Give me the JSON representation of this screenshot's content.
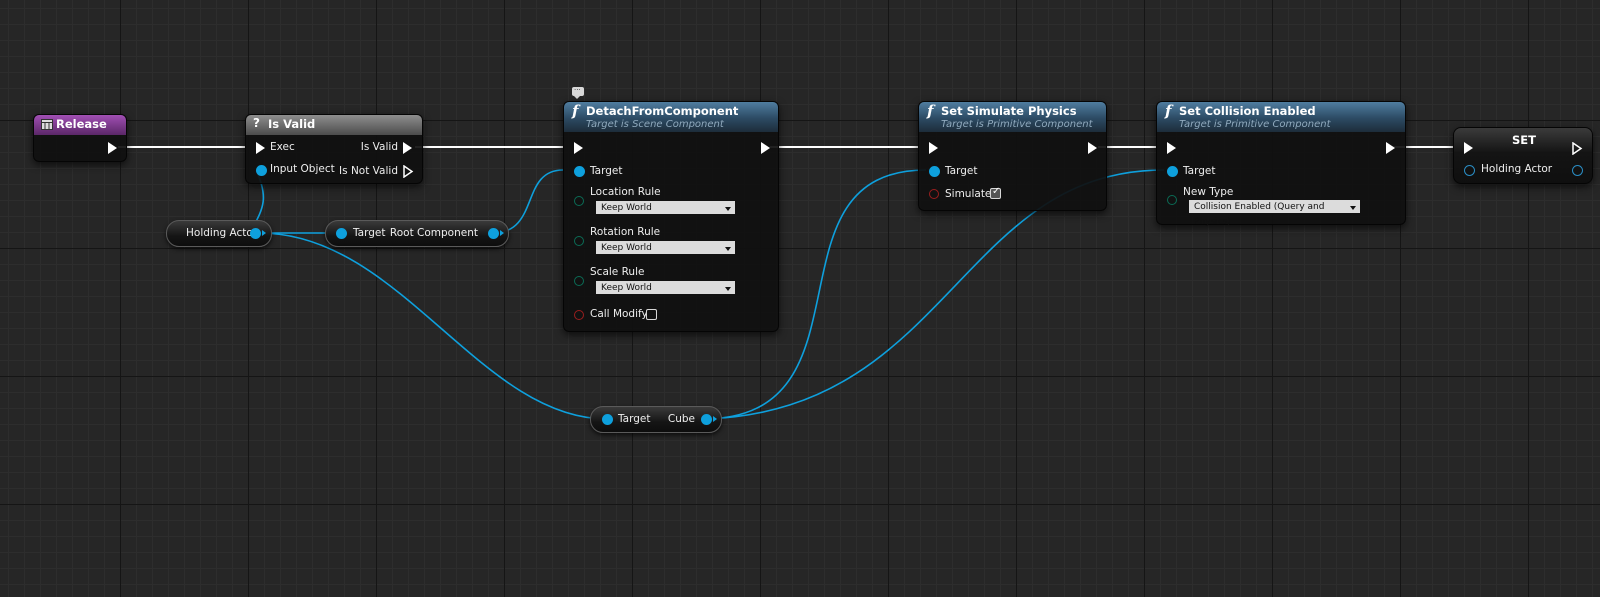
{
  "nodes": {
    "release": {
      "title": "Release"
    },
    "is_valid": {
      "title": "Is Valid",
      "icon": "?",
      "exec_in": "Exec",
      "input_object": "Input Object",
      "is_valid_out": "Is Valid",
      "is_not_valid_out": "Is Not Valid"
    },
    "holding_actor_get": {
      "label": "Holding Actor"
    },
    "root_component_get": {
      "target": "Target",
      "output": "Root Component"
    },
    "detach": {
      "title": "DetachFromComponent",
      "subtitle": "Target is Scene Component",
      "icon": "f",
      "target": "Target",
      "location_rule": "Location Rule",
      "location_value": "Keep World",
      "rotation_rule": "Rotation Rule",
      "rotation_value": "Keep World",
      "scale_rule": "Scale Rule",
      "scale_value": "Keep World",
      "call_modify": "Call Modify"
    },
    "cube_get": {
      "target": "Target",
      "output": "Cube"
    },
    "set_simulate": {
      "title": "Set Simulate Physics",
      "subtitle": "Target is Primitive Component",
      "icon": "f",
      "target": "Target",
      "simulate": "Simulate"
    },
    "set_collision": {
      "title": "Set Collision Enabled",
      "subtitle": "Target is Primitive Component",
      "icon": "f",
      "target": "Target",
      "new_type": "New Type",
      "new_type_value": "Collision Enabled (Query and Physics)"
    },
    "set_var": {
      "title": "SET",
      "holding_actor": "Holding Actor"
    }
  },
  "colors": {
    "exec_wire": "#ffffff",
    "object_wire": "#0ea0dd",
    "event_header": "#8a3e9c",
    "function_header": "#3d6585",
    "bool_pin": "#9a1e1e",
    "byte_pin": "#0b6b55"
  },
  "checkboxes": {
    "simulate_checked": true,
    "call_modify_checked": false
  }
}
